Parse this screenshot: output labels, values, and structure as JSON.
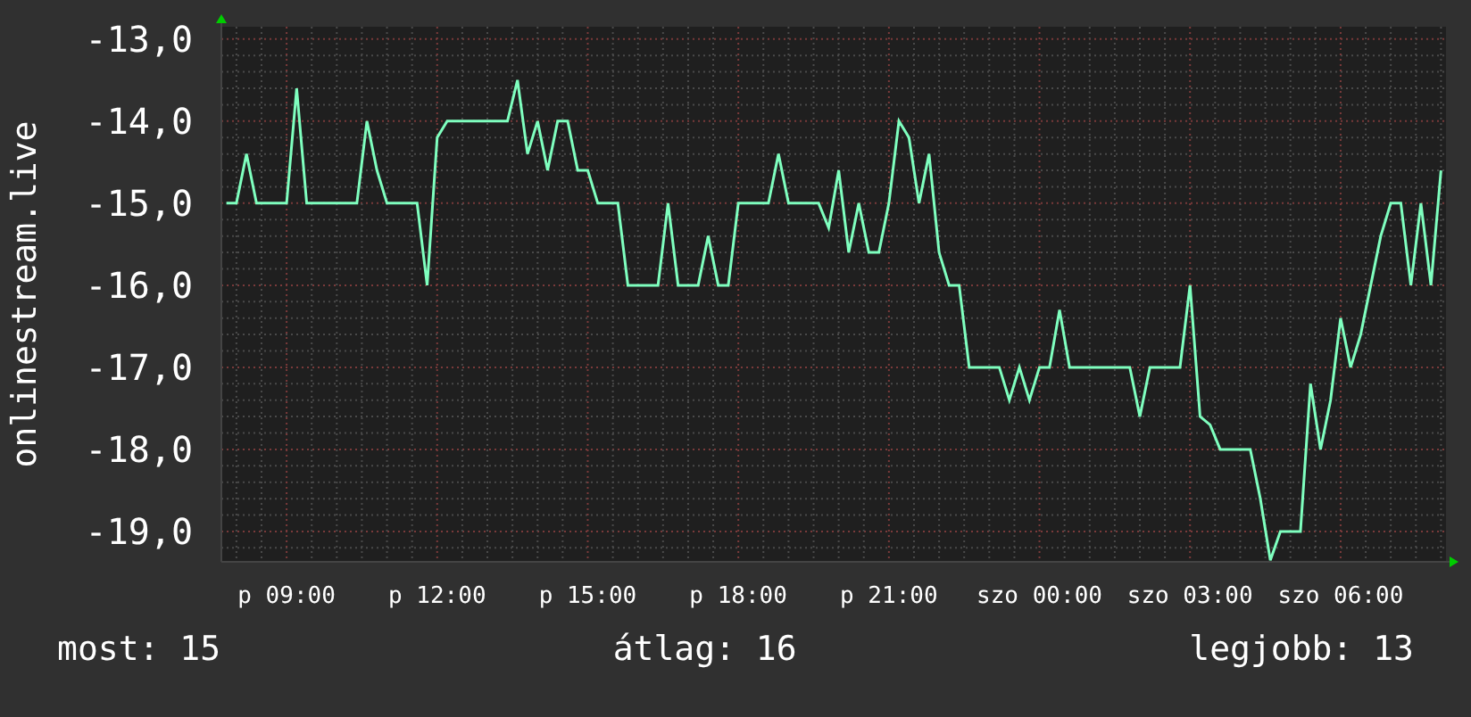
{
  "chart_data": {
    "type": "line",
    "ylabel": "onlinestream.live",
    "categories": [
      null,
      null,
      null,
      null,
      null,
      null,
      "p 09:00",
      null,
      null,
      null,
      null,
      null,
      null,
      null,
      null,
      null,
      null,
      null,
      null,
      null,
      null,
      "p 12:00",
      null,
      null,
      null,
      null,
      null,
      null,
      null,
      null,
      null,
      null,
      null,
      null,
      null,
      null,
      "p 15:00",
      null,
      null,
      null,
      null,
      null,
      null,
      null,
      null,
      null,
      null,
      null,
      null,
      null,
      null,
      "p 18:00",
      null,
      null,
      null,
      null,
      null,
      null,
      null,
      null,
      null,
      null,
      null,
      null,
      null,
      null,
      "p 21:00",
      null,
      null,
      null,
      null,
      null,
      null,
      null,
      null,
      null,
      null,
      null,
      null,
      null,
      null,
      "szo 00:00",
      null,
      null,
      null,
      null,
      null,
      null,
      null,
      null,
      null,
      null,
      null,
      null,
      null,
      null,
      "szo 03:00",
      null,
      null,
      null,
      null,
      null,
      null,
      null,
      null,
      null,
      null,
      null,
      null,
      null,
      null,
      "szo 06:00",
      null,
      null,
      null,
      null,
      null,
      null,
      null,
      null,
      null,
      null
    ],
    "series": [
      {
        "color": "#7fffbf",
        "values": [
          -15,
          -15,
          -14.4,
          -15,
          -15,
          -15,
          -15,
          -13.6,
          -15,
          -15,
          -15,
          -15,
          -15,
          -15,
          -14,
          -14.6,
          -15,
          -15,
          -15,
          -15,
          -16,
          -14.2,
          -14,
          -14,
          -14,
          -14,
          -14,
          -14,
          -14,
          -13.5,
          -14.4,
          -14,
          -14.6,
          -14,
          -14,
          -14.6,
          -14.6,
          -15,
          -15,
          -15,
          -16,
          -16,
          -16,
          -16,
          -15,
          -16,
          -16,
          -16,
          -15.4,
          -16,
          -16,
          -15,
          -15,
          -15,
          -15,
          -14.4,
          -15,
          -15,
          -15,
          -15,
          -15.3,
          -14.6,
          -15.6,
          -15,
          -15.6,
          -15.6,
          -15,
          -14,
          -14.2,
          -15,
          -14.4,
          -15.6,
          -16,
          -16,
          -17,
          -17,
          -17,
          -17,
          -17.4,
          -17,
          -17.4,
          -17,
          -17,
          -16.3,
          -17,
          -17,
          -17,
          -17,
          -17,
          -17,
          -17,
          -17.6,
          -17,
          -17,
          -17,
          -17,
          -16,
          -17.6,
          -17.7,
          -18,
          -18,
          -18,
          -18,
          -18.6,
          -19.35,
          -19,
          -19,
          -19,
          -17.2,
          -18,
          -17.4,
          -16.4,
          -17,
          -16.6,
          -16,
          -15.4,
          -15,
          -15,
          -16,
          -15,
          -16,
          -14.6
        ]
      }
    ],
    "ylim": [
      -19.37,
      -12.85
    ],
    "grid": true,
    "yticks": [
      {
        "value": -13,
        "label": "-13,0"
      },
      {
        "value": -14,
        "label": "-14,0"
      },
      {
        "value": -15,
        "label": "-15,0"
      },
      {
        "value": -16,
        "label": "-16,0"
      },
      {
        "value": -17,
        "label": "-17,0"
      },
      {
        "value": -18,
        "label": "-18,0"
      },
      {
        "value": -19,
        "label": "-19,0"
      }
    ]
  },
  "legend": [
    "most: 15",
    "átlag: 16",
    "legjobb: 13"
  ]
}
